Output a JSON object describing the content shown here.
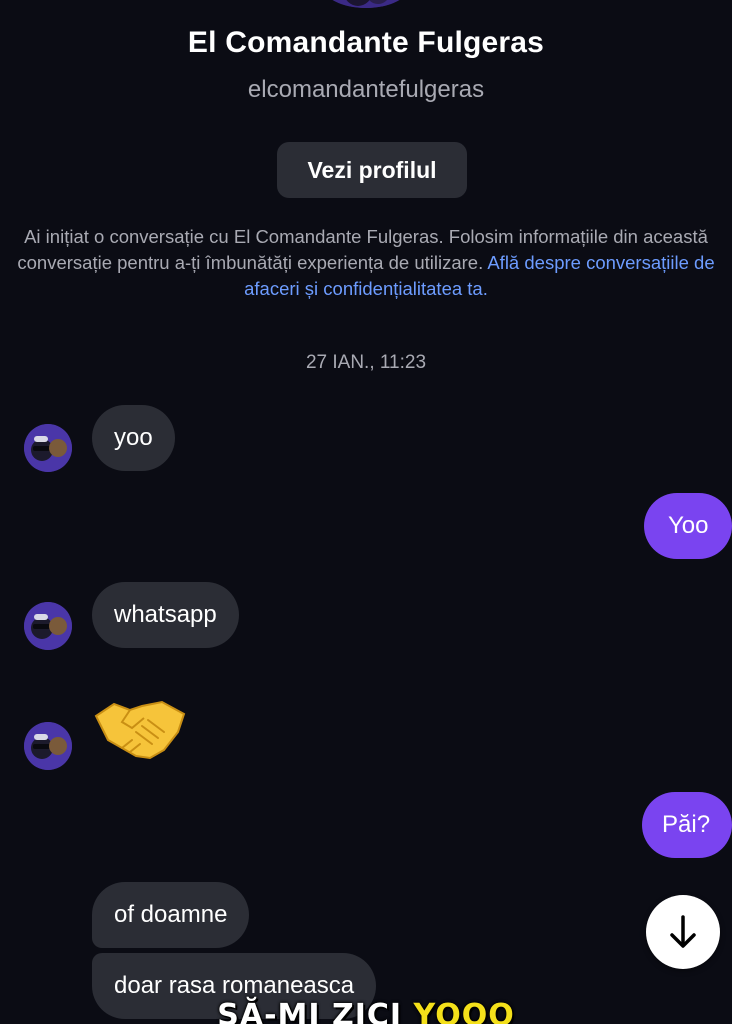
{
  "profile": {
    "name": "El Comandante Fulgeras",
    "handle": "elcomandantefulgeras",
    "view_profile_label": "Vezi profilul"
  },
  "info": {
    "text": "Ai inițiat o conversație cu El Comandante Fulgeras. Folosim informațiile din această conversație pentru a-ți îmbunătăți experiența de utilizare.",
    "link_text": "Află despre conversațiile de afaceri și confidențialitatea ta."
  },
  "timestamp": "27 IAN., 11:23",
  "messages": [
    {
      "direction": "incoming",
      "text": "yoo"
    },
    {
      "direction": "outgoing",
      "text": "Yoo"
    },
    {
      "direction": "incoming",
      "text": "whatsapp"
    },
    {
      "direction": "incoming",
      "text": "",
      "emoji": "handshake-icon"
    },
    {
      "direction": "outgoing",
      "text": "Păi?"
    },
    {
      "direction": "incoming",
      "text": "of doamne"
    },
    {
      "direction": "incoming",
      "text": "doar rasa romaneasca"
    }
  ],
  "caption": {
    "part1": "SĂ-MI ZICI ",
    "part2": "YOOO"
  },
  "icons": {
    "scroll_down": "arrow-down-icon",
    "handshake": "handshake-icon"
  },
  "colors": {
    "background": "#0b0c14",
    "incoming_bubble": "#2b2d35",
    "outgoing_bubble": "#7a44f0",
    "link": "#6d9cff",
    "caption_highlight": "#f4e01a"
  }
}
